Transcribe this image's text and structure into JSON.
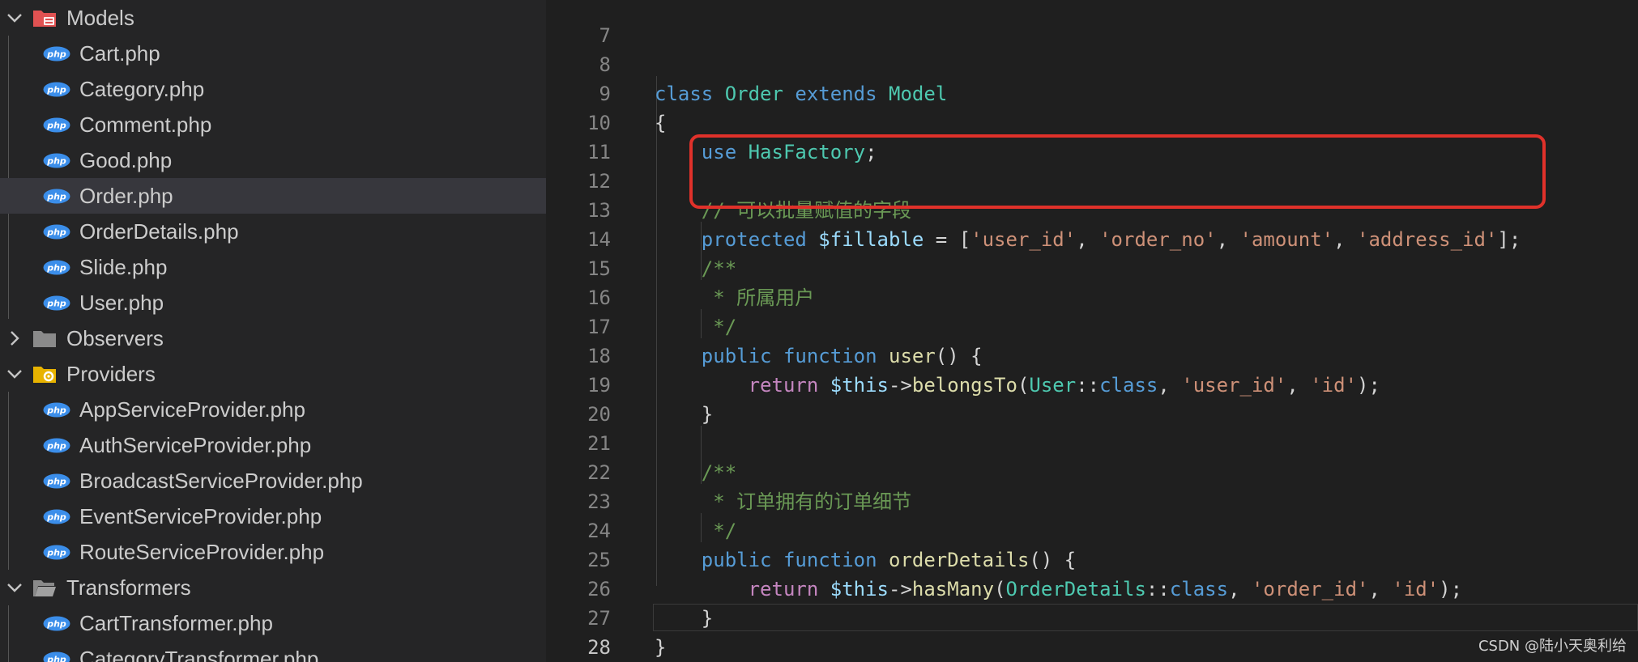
{
  "explorer": {
    "folder_models": "Models",
    "models_files": [
      "Cart.php",
      "Category.php",
      "Comment.php",
      "Good.php",
      "Order.php",
      "OrderDetails.php",
      "Slide.php",
      "User.php"
    ],
    "folder_observers": "Observers",
    "folder_providers": "Providers",
    "providers_files": [
      "AppServiceProvider.php",
      "AuthServiceProvider.php",
      "BroadcastServiceProvider.php",
      "EventServiceProvider.php",
      "RouteServiceProvider.php"
    ],
    "folder_transformers": "Transformers",
    "transformers_files": [
      "CartTransformer.php",
      "CategoryTransformer.php"
    ],
    "selected_file": "Order.php",
    "php_badge": "php"
  },
  "editor": {
    "line_numbers": [
      "7",
      "8",
      "9",
      "10",
      "11",
      "12",
      "13",
      "14",
      "15",
      "16",
      "17",
      "18",
      "19",
      "20",
      "21",
      "22",
      "23",
      "24",
      "25",
      "26",
      "27",
      "28"
    ],
    "current_line": "28",
    "tokens": {
      "class_kw": "class",
      "class_name": "Order",
      "extends_kw": "extends",
      "parent_name": "Model",
      "open_brace": "{",
      "close_brace": "}",
      "use_kw": "use",
      "trait_name": "HasFactory",
      "semicolon": ";",
      "comment_fillable": "// 可以批量赋值的字段",
      "protected_kw": "protected",
      "fillable_var": "$fillable",
      "assign": " = [",
      "fill_1": "'user_id'",
      "fill_2": "'order_no'",
      "fill_3": "'amount'",
      "fill_4": "'address_id'",
      "comma": ", ",
      "close_arr": "];",
      "doc_open": "/**",
      "doc_user": " * 所属用户",
      "doc_close": " */",
      "public_kw": "public",
      "function_kw": "function",
      "user_fn": "user",
      "parens_open": "() {",
      "return_kw": "return",
      "this_var": "$this",
      "arrow": "->",
      "belongs_to": "belongsTo",
      "paren_l": "(",
      "user_class": "User",
      "dcolon": "::",
      "class_const": "class",
      "str_user_id": "'user_id'",
      "str_id": "'id'",
      "paren_close_semi": ");",
      "doc_details": " * 订单拥有的订单细节",
      "details_fn": "orderDetails",
      "has_many": "hasMany",
      "details_class": "OrderDetails",
      "str_order_id": "'order_id'"
    }
  },
  "watermark": "CSDN @陆小天奥利给",
  "colors": {
    "highlight_box": "#e0312a",
    "php_icon": "#3b8eea",
    "folder_models": "#e05252",
    "folder_providers": "#e8b300"
  }
}
